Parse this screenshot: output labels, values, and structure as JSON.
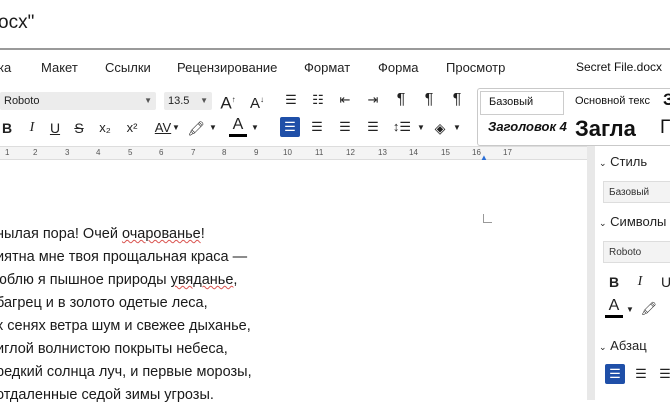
{
  "window": {
    "title": "ocx\""
  },
  "menu": {
    "items": [
      "ка",
      "Макет",
      "Ссылки",
      "Рецензирование",
      "Формат",
      "Форма",
      "Просмотр"
    ],
    "filename": "Secret File.docx"
  },
  "toolbar": {
    "font": "Roboto",
    "size": "13.5",
    "bold": "B",
    "italic": "I",
    "underline": "U",
    "strike": "S",
    "subscript": "x₂",
    "superscript": "x²",
    "spacing": "AV",
    "font_color": "A"
  },
  "styles": {
    "basic": "Базовый",
    "main_text": "Основной текс",
    "heading4": "Заголовок 4",
    "heading_big": "Загла",
    "heading_partial": "З",
    "heading_partial2": "Г"
  },
  "ruler": {
    "numbers": [
      "1",
      "1",
      "2",
      "3",
      "4",
      "5",
      "6",
      "7",
      "8",
      "9",
      "10",
      "11",
      "12",
      "13",
      "14",
      "15",
      "16",
      "17"
    ]
  },
  "document": {
    "lines": [
      "нылая пора! Очей очарованье!",
      "иятна мне твоя прощальная краса —",
      "юблю я пышное природы увяданье,",
      "багрец и в золото одетые леса,",
      "х сенях ветра шум и свежее дыханье,",
      "иглой волнистою покрыты небеса,",
      "редкий солнца луч, и первые морозы,",
      "отдаленные седой зимы угрозы."
    ]
  },
  "panel": {
    "style_heading": "Стиль",
    "style_value": "Базовый",
    "symbols_heading": "Символы",
    "font_value": "Roboto",
    "bold": "B",
    "italic": "I",
    "underline": "U",
    "paragraph_heading": "Абзац"
  },
  "colors": {
    "accent": "#1f4fa8",
    "font_color_bar": "#000000"
  }
}
